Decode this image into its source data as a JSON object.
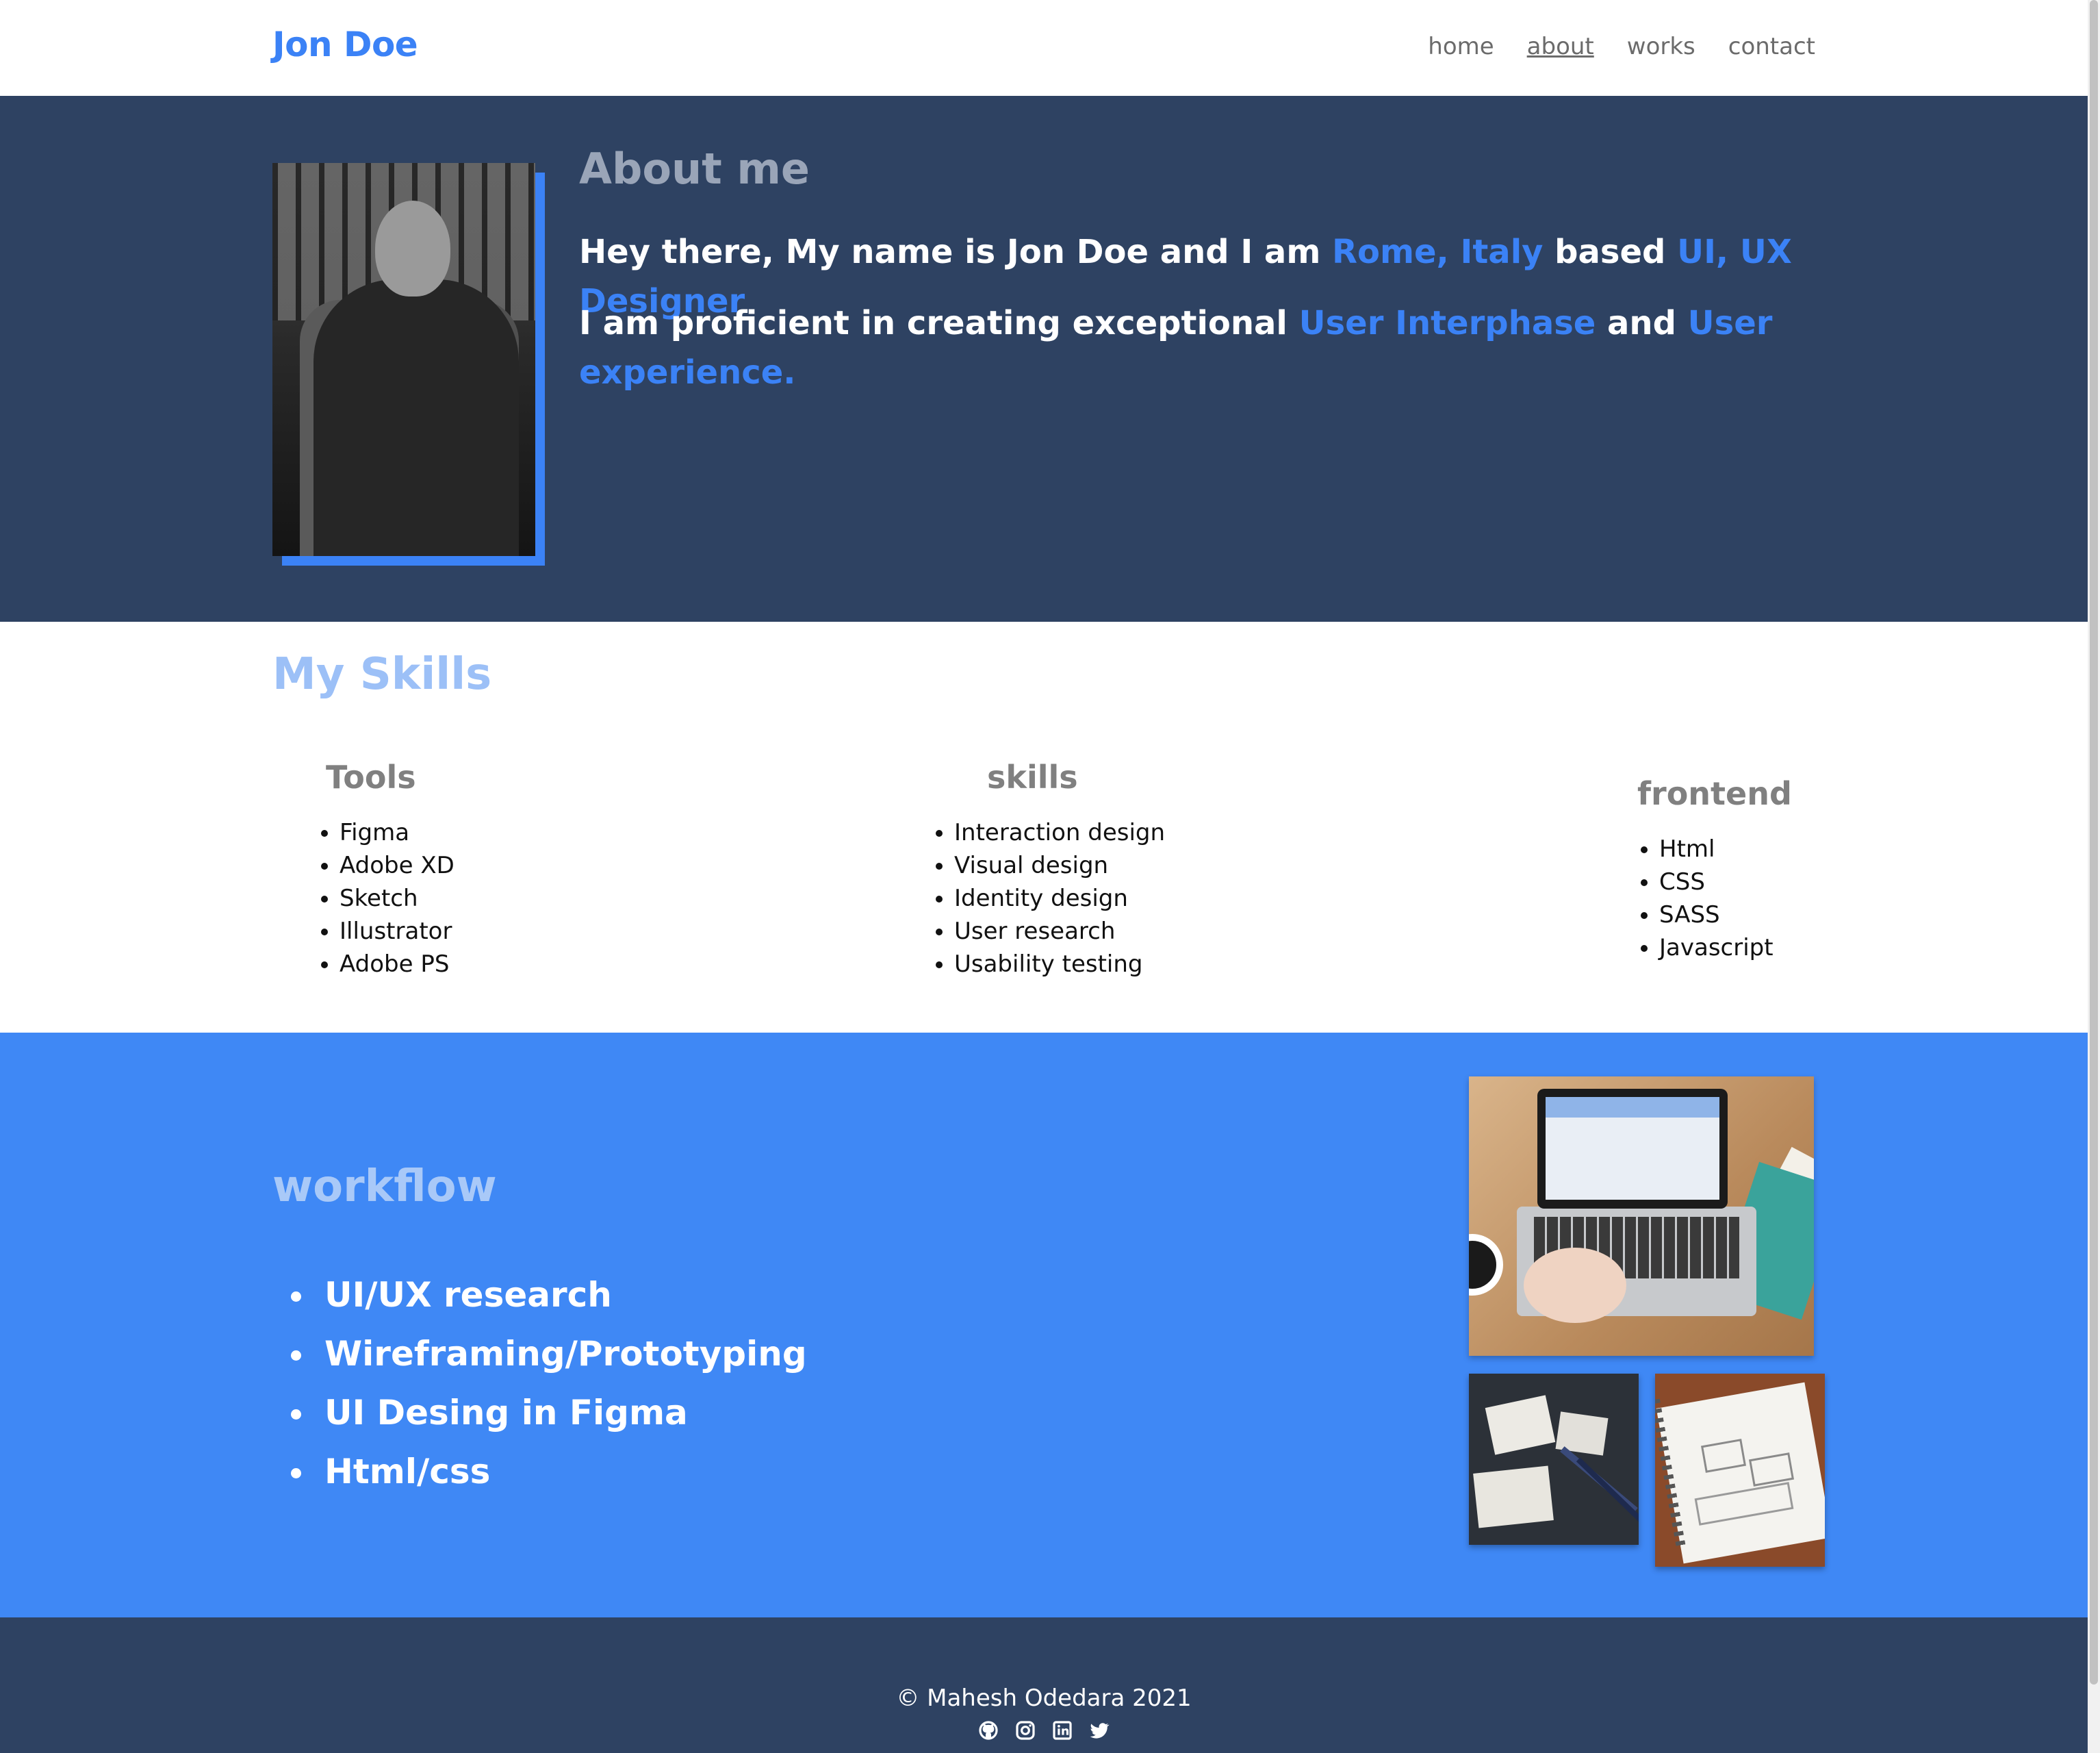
{
  "header": {
    "logo": "Jon Doe",
    "nav": [
      {
        "label": "home",
        "active": false
      },
      {
        "label": "about",
        "active": true
      },
      {
        "label": "works",
        "active": false
      },
      {
        "label": "contact",
        "active": false
      }
    ]
  },
  "about": {
    "title": "About me",
    "line1": {
      "part1": "Hey there, My name is Jon Doe and I am ",
      "location": "Rome, Italy",
      "part2": " based ",
      "role": "UI, UX Designer"
    },
    "line2": {
      "part1": "I am proficient in creating exceptional ",
      "hl1": "User Interphase",
      "part2": " and ",
      "hl2": "User experience."
    }
  },
  "skills": {
    "title": "My Skills",
    "columns": [
      {
        "heading": "Tools",
        "items": [
          "Figma",
          "Adobe XD",
          "Sketch",
          "Illustrator",
          "Adobe PS"
        ]
      },
      {
        "heading": "skills",
        "items": [
          "Interaction design",
          "Visual design",
          "Identity design",
          "User research",
          "Usability testing"
        ]
      },
      {
        "heading": "frontend",
        "items": [
          "Html",
          "CSS",
          "SASS",
          "Javascript"
        ]
      }
    ]
  },
  "workflow": {
    "title": "workflow",
    "items": [
      "UI/UX research",
      "Wireframing/Prototyping",
      "UI Desing in Figma",
      "Html/css"
    ]
  },
  "footer": {
    "copyright": "© Mahesh Odedara 2021",
    "socials": [
      "github-icon",
      "instagram-icon",
      "linkedin-icon",
      "twitter-icon"
    ]
  },
  "colors": {
    "accent": "#3b82f6",
    "navy": "#2e4262",
    "workflow_bg": "#3f88f5"
  }
}
